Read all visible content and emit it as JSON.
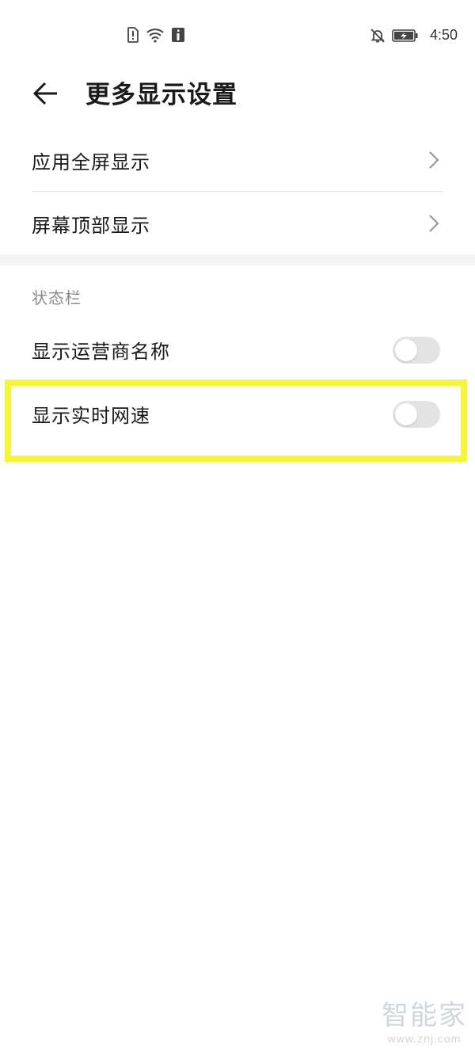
{
  "status_bar": {
    "time": "4:50",
    "icons_left": [
      "sim-alert-icon",
      "wifi-icon",
      "info-notification-icon"
    ],
    "icons_right": [
      "bell-muted-icon",
      "battery-charging-icon"
    ]
  },
  "header": {
    "title": "更多显示设置",
    "back_icon": "arrow-left-icon"
  },
  "rows": [
    {
      "label": "应用全屏显示",
      "type": "nav"
    },
    {
      "label": "屏幕顶部显示",
      "type": "nav"
    }
  ],
  "section": {
    "title": "状态栏",
    "toggles": [
      {
        "label": "显示运营商名称",
        "checked": false
      },
      {
        "label": "显示实时网速",
        "checked": false
      }
    ]
  },
  "highlight_color": "#f5f53a",
  "watermark": {
    "main": "智能家",
    "sub": "www.znj.com"
  }
}
